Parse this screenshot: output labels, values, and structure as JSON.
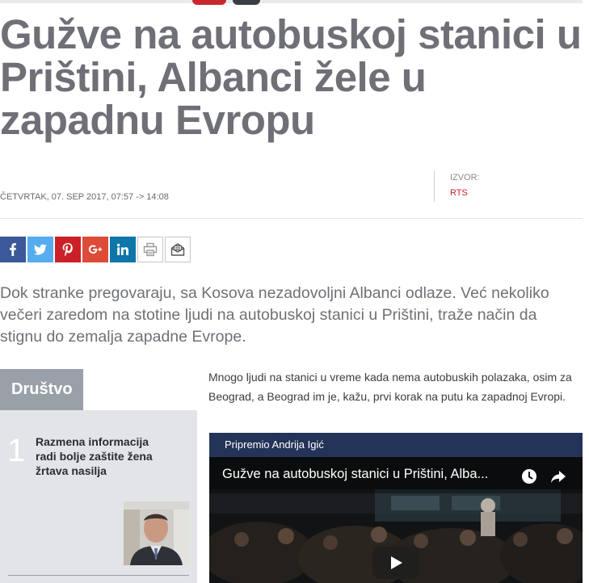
{
  "article": {
    "title": "Gužve na autobuskoj stanici u Prištini, Albanci žele u zapadnu Evropu",
    "date": "ČETVRTAK, 07. SEP 2017, 07:57 -> 14:08",
    "source_label": "IZVOR:",
    "source_name": "RTS",
    "lead": "Dok stranke pregovaraju, sa Kosova nezadovoljni Albanci odlaze. Već nekoliko večeri zaredom na stotine ljudi na autobuskoj stanici u Prištini, traže način da stignu do zemalja zapadne Evrope.",
    "body": "Mnogo ljudi na stanici u vreme kada nema autobuskih polazaka, osim za Beograd, a Beograd im je, kažu, prvi korak na putu ka zapadnoj Evropi."
  },
  "share": {
    "icons": [
      "facebook-icon",
      "twitter-icon",
      "pinterest-icon",
      "google-plus-icon",
      "linkedin-icon",
      "print-icon",
      "email-icon"
    ],
    "colors": {
      "facebook": "#3b5998",
      "twitter": "#55acee",
      "pinterest": "#cb2027",
      "google_plus": "#dd4b39",
      "linkedin": "#0e76a8"
    }
  },
  "sidebar": {
    "section": "Društvo",
    "items": [
      {
        "rank": "1",
        "title": "Razmena informacija radi bolje zaštite žena žrtava nasilja"
      }
    ]
  },
  "video": {
    "credit": "Pripremio Andrija Igić",
    "title": "Gužve na autobuskoj stanici u Prištini, Alba...",
    "icons": [
      "watch-later-icon",
      "share-arrow-icon",
      "play-icon"
    ]
  },
  "colors": {
    "headline": "#6f7077",
    "accent": "#c8282d",
    "video_header": "#233458",
    "sidebar_tab": "#9aa0a8"
  }
}
